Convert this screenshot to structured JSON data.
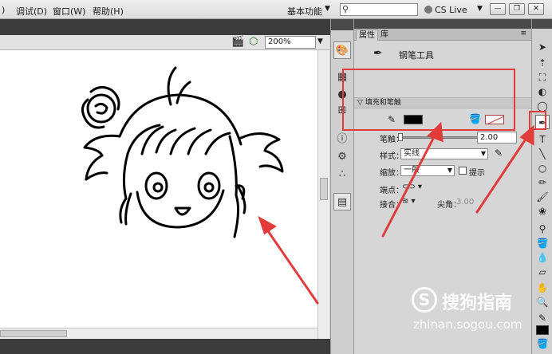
{
  "menubar": {
    "items": [
      ")",
      "调试(D)",
      "窗口(W)",
      "帮助(H)"
    ],
    "workspace": "基本功能",
    "live": "CS Live"
  },
  "document": {
    "zoom": "200%"
  },
  "panel": {
    "tabs": [
      "属性",
      "库"
    ],
    "tool_name": "钢笔工具",
    "section": "填充和笔触",
    "stroke_label": "笔触：",
    "stroke_value": "2.00",
    "style_label": "样式：",
    "style_value": "实线",
    "scale_label": "缩放：",
    "scale_value": "一般",
    "hint_label": "提示",
    "cap_label": "端点：",
    "join_label": "接合：",
    "miter_label": "尖角：",
    "miter_value": "3.00"
  },
  "watermark": {
    "title": "搜狗指南",
    "url": "zhinan.sogou.com"
  },
  "colors": {
    "stroke_color": "#000000",
    "annotation_red": "#e23b3b",
    "chrome_dark": "#3c3c3c"
  }
}
